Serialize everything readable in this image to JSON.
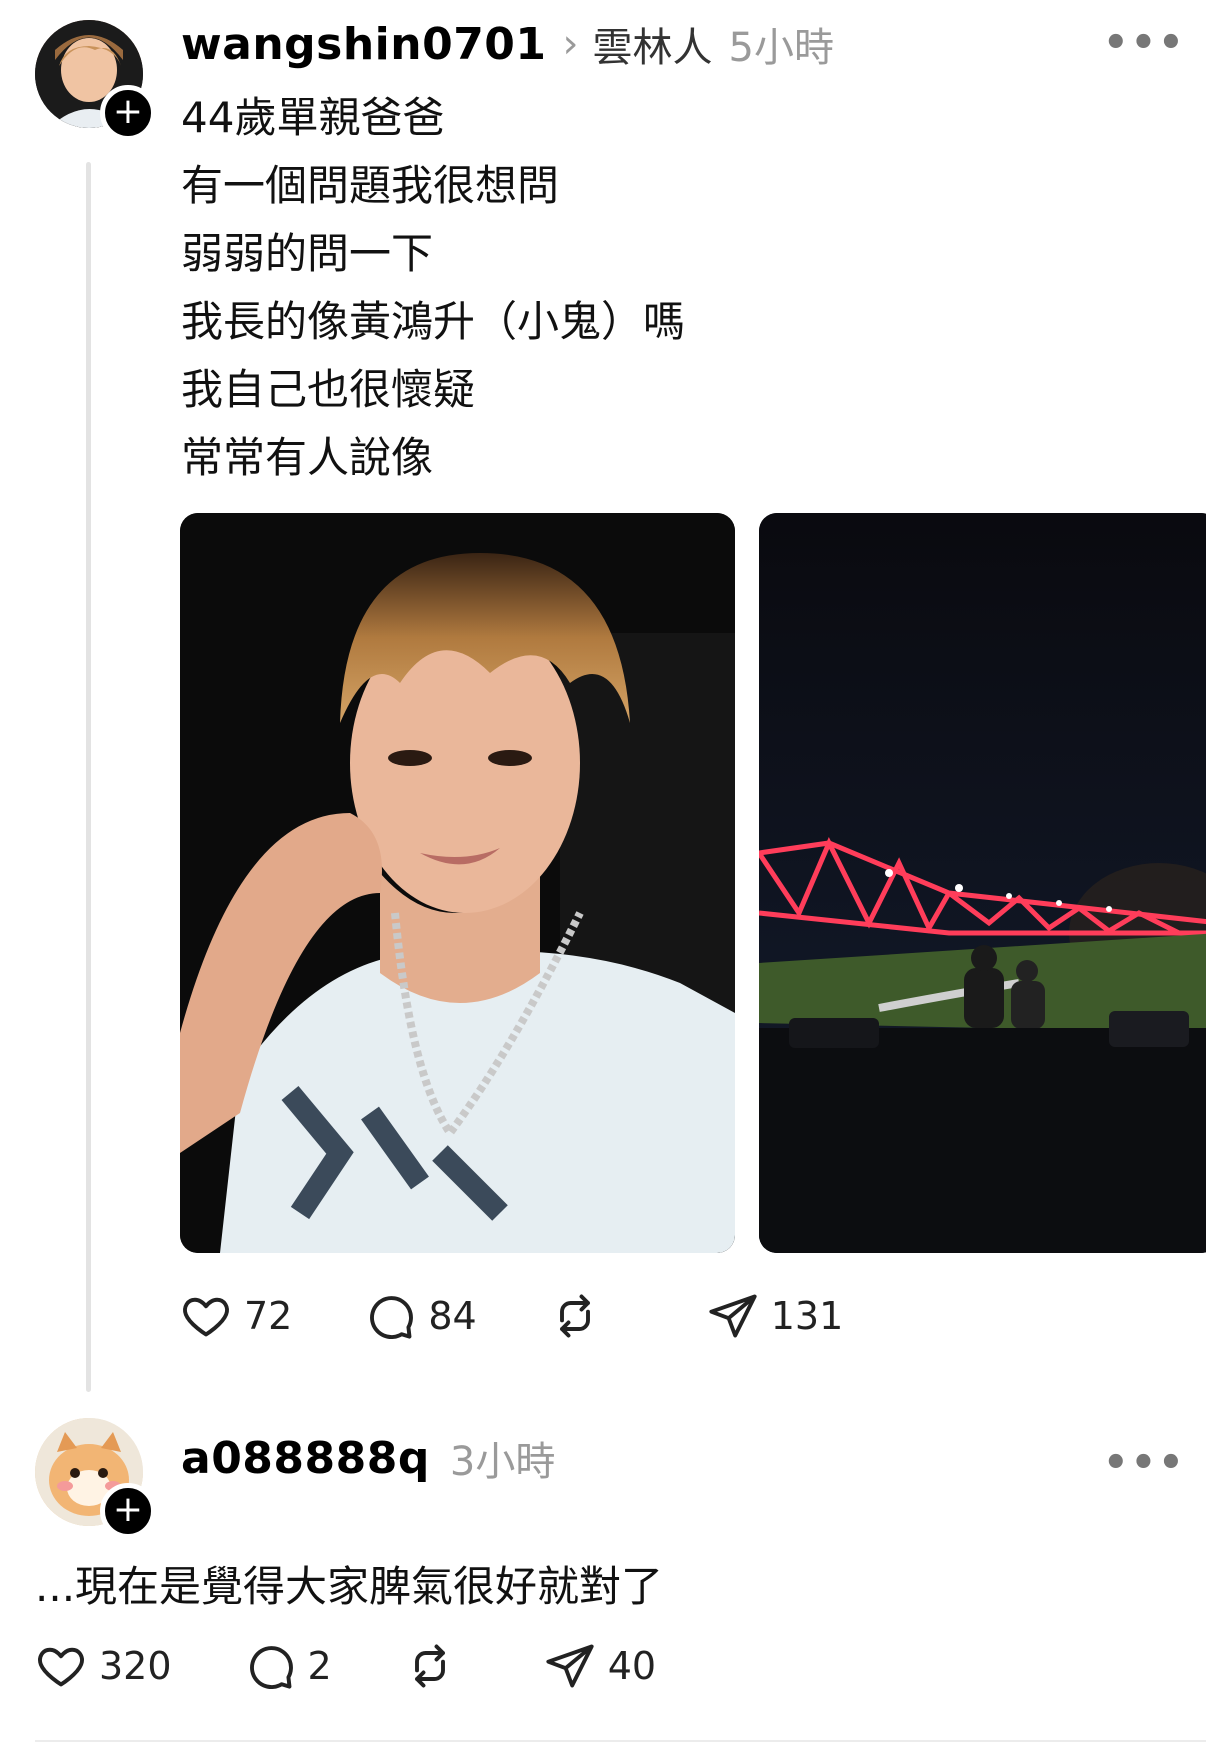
{
  "post": {
    "username": "wangshin0701",
    "separator": "›",
    "location": "雲林人",
    "time": "5小時",
    "more": "•••",
    "lines": [
      "44歲單親爸爸",
      "有一個問題我很想問",
      "弱弱的問一下",
      "我長的像黃鴻升（小鬼）嗎",
      "我自己也很懷疑",
      "常常有人說像"
    ],
    "stats": {
      "likes": "72",
      "comments": "84",
      "shares": "131"
    }
  },
  "reply": {
    "username": "a088888q",
    "time": "3小時",
    "more": "•••",
    "text": "...現在是覺得大家脾氣很好就對了",
    "stats": {
      "likes": "320",
      "comments": "2",
      "shares": "40"
    }
  },
  "icons": {
    "like": "heart-icon",
    "comment": "comment-icon",
    "repost": "repost-icon",
    "share": "send-icon",
    "follow": "plus-icon"
  }
}
